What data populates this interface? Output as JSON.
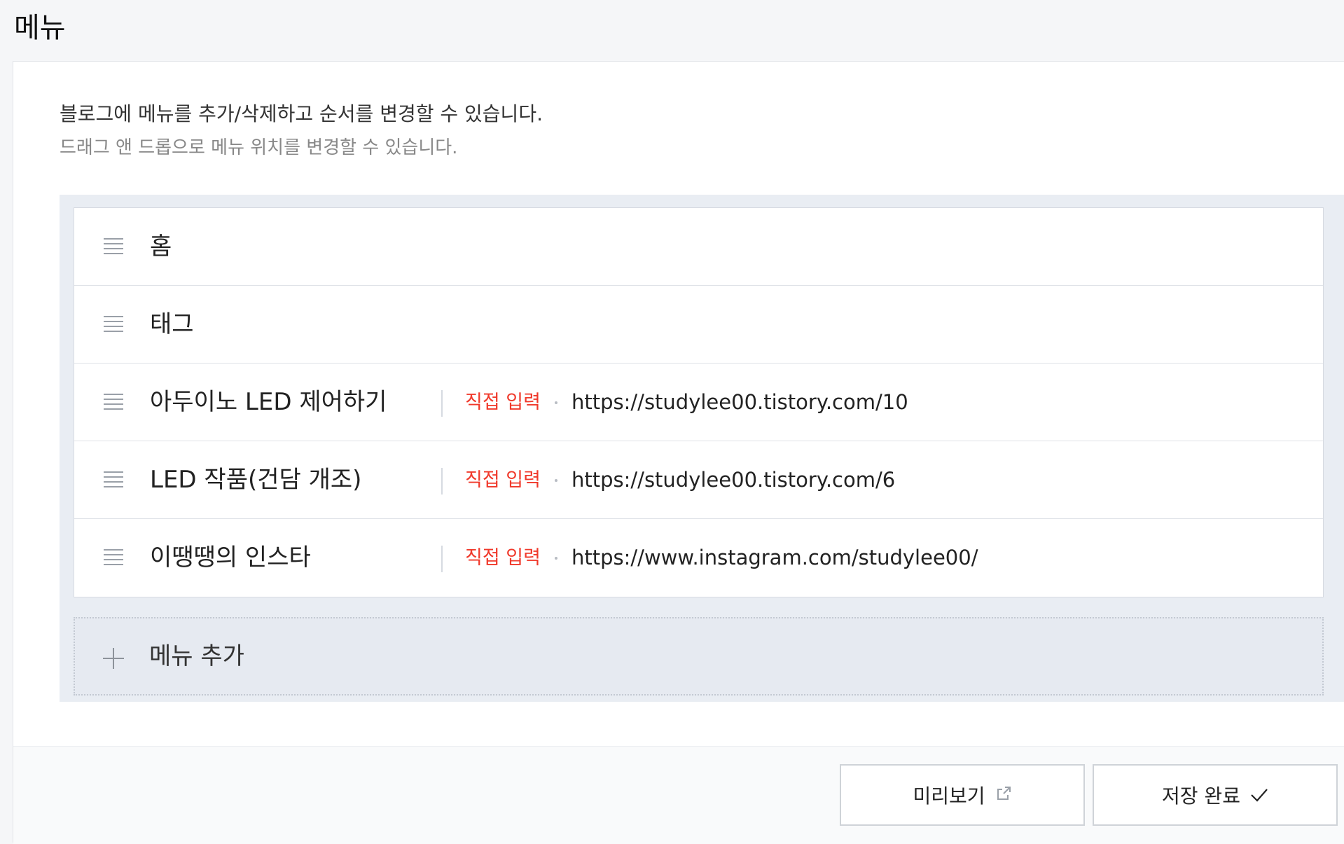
{
  "header": {
    "title": "메뉴"
  },
  "description": {
    "main": "블로그에 메뉴를 추가/삭제하고 순서를 변경할 수 있습니다.",
    "sub": "드래그 앤 드롭으로 메뉴 위치를 변경할 수 있습니다."
  },
  "menu_items": [
    {
      "name": "홈",
      "type": "",
      "url": ""
    },
    {
      "name": "태그",
      "type": "",
      "url": ""
    },
    {
      "name": "아두이노 LED 제어하기",
      "type": "직접 입력",
      "url": "https://studylee00.tistory.com/10"
    },
    {
      "name": "LED 작품(건담 개조)",
      "type": "직접 입력",
      "url": "https://studylee00.tistory.com/6"
    },
    {
      "name": "이땡땡의 인스타",
      "type": "직접 입력",
      "url": "https://www.instagram.com/studylee00/"
    }
  ],
  "add_menu": {
    "label": "메뉴 추가",
    "icon": "plus-icon"
  },
  "footer": {
    "preview_label": "미리보기",
    "preview_icon": "external-link-icon",
    "save_label": "저장 완료",
    "save_icon": "check-icon"
  },
  "colors": {
    "accent_red": "#f0392b",
    "list_background": "#e9edf3",
    "page_background": "#f5f6f8"
  }
}
